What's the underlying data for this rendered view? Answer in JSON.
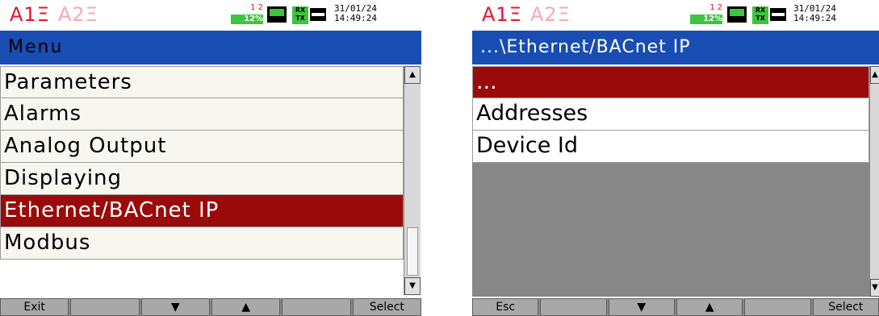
{
  "left_screen": {
    "status": {
      "channel1": "A1Ξ",
      "channel2": "A2Ξ",
      "mem_nums": "1 2",
      "mem_pct": "12%",
      "rx": "RX",
      "tx": "TX",
      "date": "31/01/24",
      "time": "14:49:24"
    },
    "title": "Menu",
    "items": [
      {
        "label": "Parameters"
      },
      {
        "label": "Alarms"
      },
      {
        "label": "Analog Output"
      },
      {
        "label": "Displaying"
      },
      {
        "label": "Ethernet/BACnet IP",
        "selected": true
      },
      {
        "label": "Modbus"
      }
    ],
    "softkeys": [
      "Exit",
      "",
      "▼",
      "▲",
      "",
      "Select"
    ]
  },
  "right_screen": {
    "status": {
      "channel1": "A1Ξ",
      "channel2": "A2Ξ",
      "mem_nums": "1 2",
      "mem_pct": "12%",
      "rx": "RX",
      "tx": "TX",
      "date": "31/01/24",
      "time": "14:49:24"
    },
    "title": "...\\Ethernet/BACnet IP",
    "items": [
      {
        "label": "...",
        "selected": true
      },
      {
        "label": "Addresses"
      },
      {
        "label": "Device Id"
      }
    ],
    "softkeys": [
      "Esc",
      "",
      "▼",
      "▲",
      "",
      "Select"
    ]
  },
  "colors": {
    "title_bar": "#1a4db3",
    "selection": "#9b0a0a",
    "channel_active": "#e8112d",
    "indicator_green": "#3ec43e"
  }
}
